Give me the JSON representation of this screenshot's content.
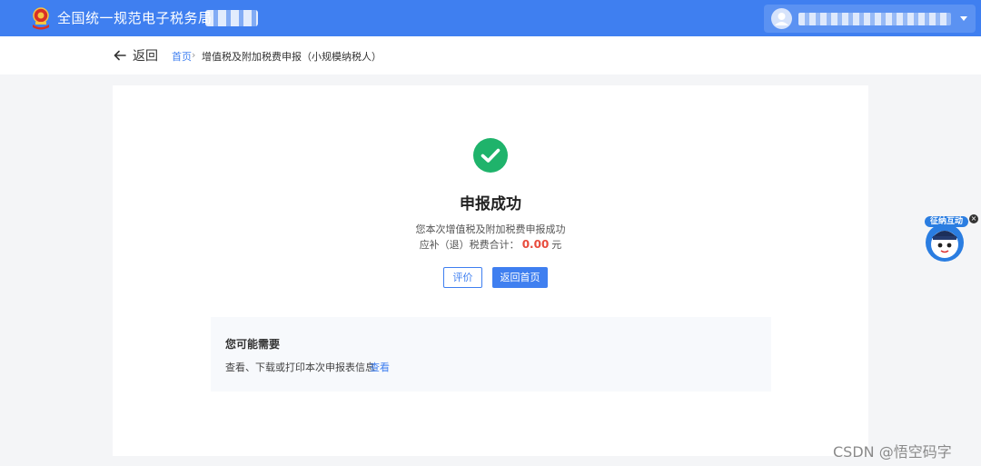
{
  "header": {
    "site_title": "全国统一规范电子税务局",
    "user_menu_icon": "chevron-down-icon"
  },
  "subnav": {
    "back_label": "返回",
    "breadcrumb": {
      "home": "首页",
      "separator": "›",
      "current": "增值税及附加税费申报（小规模纳税人）"
    }
  },
  "result": {
    "status_icon": "check-circle-icon",
    "title": "申报成功",
    "description": "您本次增值税及附加税费申报成功",
    "amount_label": "应补（退）税费合计：",
    "amount_value": "0.00",
    "amount_unit": "元",
    "buttons": {
      "rate": "评价",
      "home": "返回首页"
    }
  },
  "suggestions": {
    "title": "您可能需要",
    "item_text": "查看、下载或打印本次申报表信息",
    "item_link": "查看"
  },
  "assistant": {
    "badge_text": "征纳互动",
    "close_symbol": "×"
  },
  "watermark": "CSDN @悟空码字",
  "colors": {
    "primary": "#3f7ff0",
    "success": "#1fb36b",
    "amount": "#e84b3c",
    "page_bg": "#f4f5f7"
  }
}
